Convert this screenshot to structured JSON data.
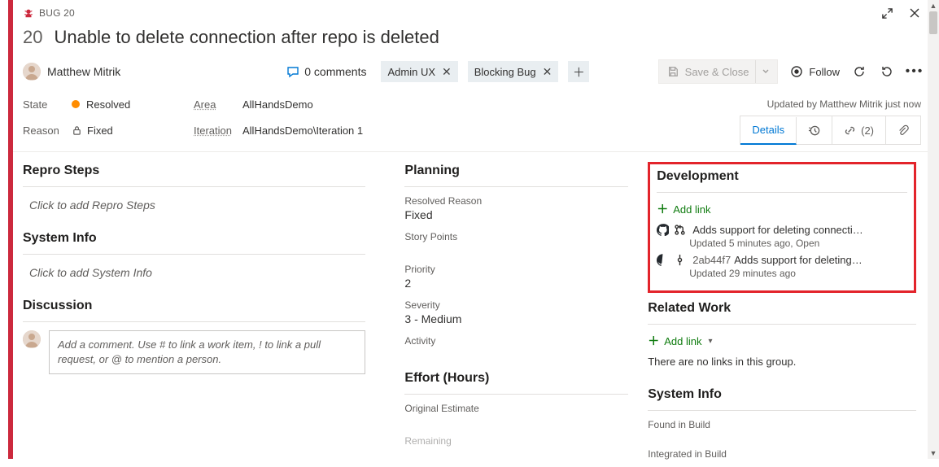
{
  "header": {
    "type_label": "BUG 20",
    "id": "20",
    "title": "Unable to delete connection after repo is deleted",
    "user": "Matthew Mitrik",
    "comments_label": "0 comments",
    "tags": [
      "Admin UX",
      "Blocking Bug"
    ],
    "save_label": "Save & Close",
    "follow_label": "Follow"
  },
  "meta": {
    "state_label": "State",
    "state_value": "Resolved",
    "reason_label": "Reason",
    "reason_value": "Fixed",
    "area_label": "Area",
    "area_value": "AllHandsDemo",
    "iteration_label": "Iteration",
    "iteration_value": "AllHandsDemo\\Iteration 1",
    "updated_text": "Updated by Matthew Mitrik just now",
    "tabs": {
      "details": "Details",
      "links_count": "(2)"
    }
  },
  "colA": {
    "repro_title": "Repro Steps",
    "repro_placeholder": "Click to add Repro Steps",
    "sysinfo_title": "System Info",
    "sysinfo_placeholder": "Click to add System Info",
    "discussion_title": "Discussion",
    "comment_placeholder": "Add a comment. Use # to link a work item, ! to link a pull request, or @ to mention a person."
  },
  "colB": {
    "planning_title": "Planning",
    "resolved_reason_label": "Resolved Reason",
    "resolved_reason_value": "Fixed",
    "story_points_label": "Story Points",
    "priority_label": "Priority",
    "priority_value": "2",
    "severity_label": "Severity",
    "severity_value": "3 - Medium",
    "activity_label": "Activity",
    "effort_title": "Effort (Hours)",
    "original_estimate_label": "Original Estimate",
    "remaining_label": "Remaining"
  },
  "colC": {
    "development_title": "Development",
    "add_link_label": "Add link",
    "dev_items": [
      {
        "title": "Adds support for deleting connecti…",
        "sub": "Updated 5 minutes ago,  Open",
        "kind": "pr"
      },
      {
        "sha": "2ab44f7",
        "title": "Adds support for deleting …",
        "sub": "Updated 29 minutes ago",
        "kind": "commit"
      }
    ],
    "related_title": "Related Work",
    "related_empty": "There are no links in this group.",
    "sysinfo_title": "System Info",
    "found_label": "Found in Build",
    "integrated_label": "Integrated in Build"
  }
}
